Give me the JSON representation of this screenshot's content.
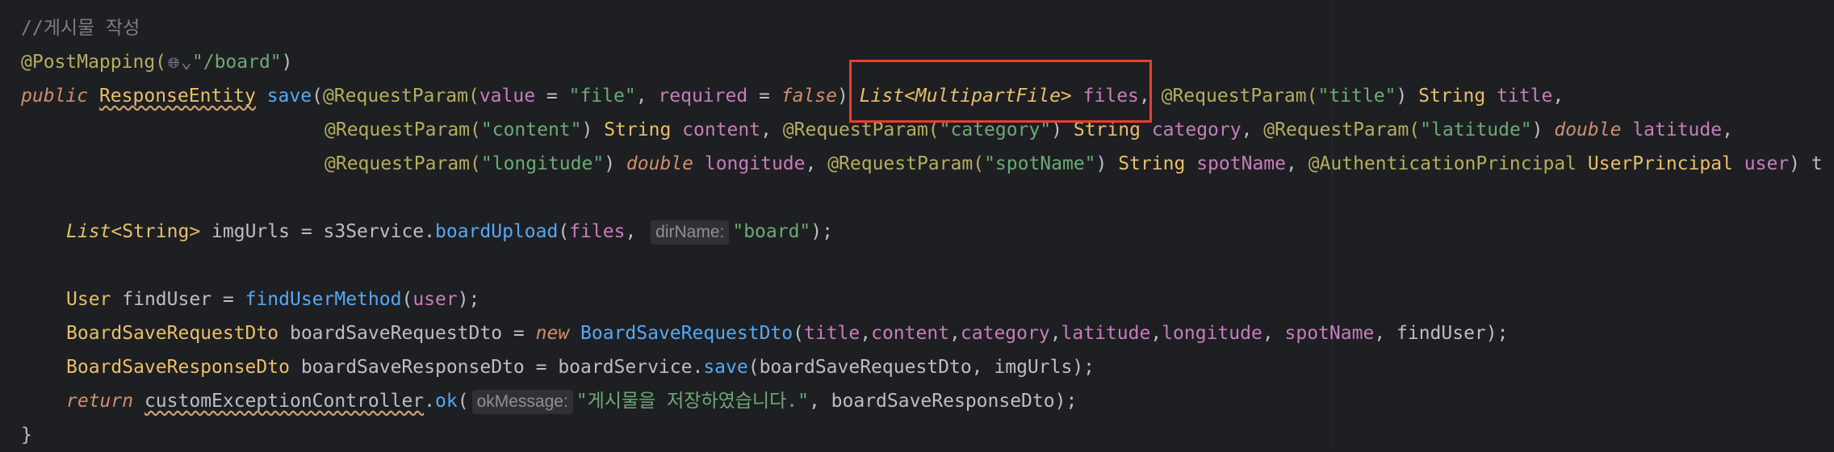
{
  "editor": {
    "comment": "//게시물 작성",
    "annotation": "@PostMapping(",
    "globe_icon": "globe-icon",
    "chevron": "⌄",
    "mapping_path": "\"/board\"",
    "line3": {
      "kw_public": "public",
      "type": "ResponseEntity",
      "method": "save",
      "ann1": "@RequestParam(",
      "value_key": "value",
      "eq": " = ",
      "file_str": "\"file\"",
      "required_key": "required",
      "false_kw": "false",
      "list_type": "List<MultipartFile>",
      "files_param": "files",
      "ann_title": "@RequestParam(",
      "title_str": "\"title\"",
      "string_type": "String",
      "title_param": "title"
    },
    "line4": {
      "ann_content": "@RequestParam(",
      "content_str": "\"content\"",
      "string_type": "String",
      "content_param": "content",
      "ann_category": "@RequestParam(",
      "category_str": "\"category\"",
      "category_param": "category",
      "ann_latitude": "@RequestParam(",
      "latitude_str": "\"latitude\"",
      "double_kw": "double",
      "latitude_param": "latitude"
    },
    "line5": {
      "ann_longitude": "@RequestParam(",
      "longitude_str": "\"longitude\"",
      "double_kw": "double",
      "longitude_param": "longitude",
      "ann_spot": "@RequestParam(",
      "spot_str": "\"spotName\"",
      "string_type": "String",
      "spot_param": "spotName",
      "auth_ann": "@AuthenticationPrincipal",
      "principal_type": "UserPrincipal",
      "user_param": "user",
      "tail": ") t"
    },
    "line7": {
      "list_type": "List",
      "generic": "<String>",
      "var": "imgUrls",
      "eq": " = ",
      "service": "s3Service.",
      "method": "boardUpload",
      "arg": "files",
      "hint": "dirName:",
      "str": "\"board\"",
      "end": ");"
    },
    "line9": {
      "type": "User",
      "var": "findUser",
      "eq": " = ",
      "method": "findUserMethod",
      "arg": "user",
      "end": ");"
    },
    "line10": {
      "type": "BoardSaveRequestDto",
      "var": "boardSaveRequestDto",
      "eq": " = ",
      "new_kw": "new",
      "ctor": "BoardSaveRequestDto",
      "args": [
        "title",
        "content",
        "category",
        "latitude",
        "longitude",
        "spotName"
      ],
      "last_arg": "findUser",
      "end": ");"
    },
    "line11": {
      "type": "BoardSaveResponseDto",
      "var": "boardSaveResponseDto",
      "eq": " = ",
      "service": "boardService.",
      "method": "save",
      "args": "boardSaveRequestDto, imgUrls",
      "end": ");"
    },
    "line12": {
      "return_kw": "return",
      "obj": "customExceptionController",
      "method": "ok",
      "hint": "okMessage:",
      "str": "\"게시물을 저장하였습니다.\"",
      "rest": ", boardSaveResponseDto);"
    },
    "closing_brace": "}"
  },
  "colors": {
    "highlight_box": "#e5402d",
    "background": "#1e1f22"
  }
}
